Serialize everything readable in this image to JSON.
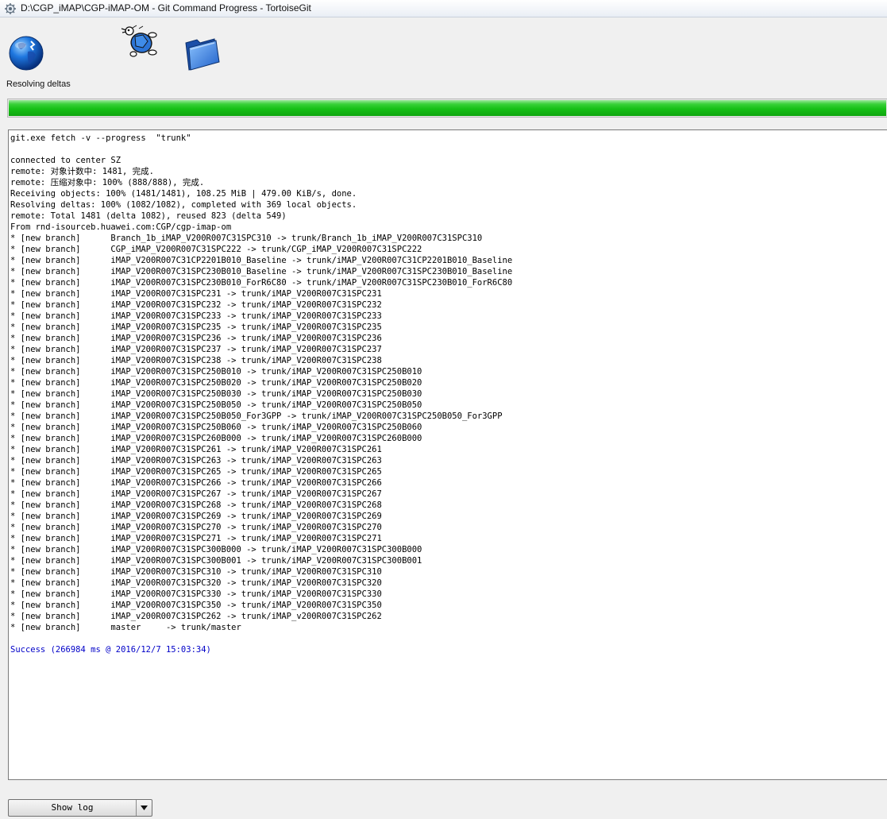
{
  "window": {
    "title": "D:\\CGP_iMAP\\CGP-iMAP-OM - Git Command Progress - TortoiseGit"
  },
  "status": {
    "text": "Resolving deltas",
    "progress_fraction": 1.0
  },
  "icons": {
    "app": "tortoisegit-icon",
    "remote": "globe-icon",
    "transfer": "turtle-icon",
    "local": "folder-icon"
  },
  "colors": {
    "progress": "#16c016",
    "success_text": "#0000c8"
  },
  "log": {
    "lines": [
      {
        "text": "git.exe fetch -v --progress  \"trunk\""
      },
      {
        "text": ""
      },
      {
        "text": "connected to center SZ"
      },
      {
        "text": "remote: 对象计数中: 1481, 完成."
      },
      {
        "text": "remote: 压缩对象中: 100% (888/888), 完成."
      },
      {
        "text": "Receiving objects: 100% (1481/1481), 108.25 MiB | 479.00 KiB/s, done."
      },
      {
        "text": "Resolving deltas: 100% (1082/1082), completed with 369 local objects."
      },
      {
        "text": "remote: Total 1481 (delta 1082), reused 823 (delta 549)"
      },
      {
        "text": "From rnd-isourceb.huawei.com:CGP/cgp-imap-om"
      },
      {
        "text": "* [new branch]      Branch_1b_iMAP_V200R007C31SPC310 -> trunk/Branch_1b_iMAP_V200R007C31SPC310"
      },
      {
        "text": "* [new branch]      CGP_iMAP_V200R007C31SPC222 -> trunk/CGP_iMAP_V200R007C31SPC222"
      },
      {
        "text": "* [new branch]      iMAP_V200R007C31CP2201B010_Baseline -> trunk/iMAP_V200R007C31CP2201B010_Baseline"
      },
      {
        "text": "* [new branch]      iMAP_V200R007C31SPC230B010_Baseline -> trunk/iMAP_V200R007C31SPC230B010_Baseline"
      },
      {
        "text": "* [new branch]      iMAP_V200R007C31SPC230B010_ForR6C80 -> trunk/iMAP_V200R007C31SPC230B010_ForR6C80"
      },
      {
        "text": "* [new branch]      iMAP_V200R007C31SPC231 -> trunk/iMAP_V200R007C31SPC231"
      },
      {
        "text": "* [new branch]      iMAP_V200R007C31SPC232 -> trunk/iMAP_V200R007C31SPC232"
      },
      {
        "text": "* [new branch]      iMAP_V200R007C31SPC233 -> trunk/iMAP_V200R007C31SPC233"
      },
      {
        "text": "* [new branch]      iMAP_V200R007C31SPC235 -> trunk/iMAP_V200R007C31SPC235"
      },
      {
        "text": "* [new branch]      iMAP_V200R007C31SPC236 -> trunk/iMAP_V200R007C31SPC236"
      },
      {
        "text": "* [new branch]      iMAP_V200R007C31SPC237 -> trunk/iMAP_V200R007C31SPC237"
      },
      {
        "text": "* [new branch]      iMAP_V200R007C31SPC238 -> trunk/iMAP_V200R007C31SPC238"
      },
      {
        "text": "* [new branch]      iMAP_V200R007C31SPC250B010 -> trunk/iMAP_V200R007C31SPC250B010"
      },
      {
        "text": "* [new branch]      iMAP_V200R007C31SPC250B020 -> trunk/iMAP_V200R007C31SPC250B020"
      },
      {
        "text": "* [new branch]      iMAP_V200R007C31SPC250B030 -> trunk/iMAP_V200R007C31SPC250B030"
      },
      {
        "text": "* [new branch]      iMAP_V200R007C31SPC250B050 -> trunk/iMAP_V200R007C31SPC250B050"
      },
      {
        "text": "* [new branch]      iMAP_V200R007C31SPC250B050_For3GPP -> trunk/iMAP_V200R007C31SPC250B050_For3GPP"
      },
      {
        "text": "* [new branch]      iMAP_V200R007C31SPC250B060 -> trunk/iMAP_V200R007C31SPC250B060"
      },
      {
        "text": "* [new branch]      iMAP_V200R007C31SPC260B000 -> trunk/iMAP_V200R007C31SPC260B000"
      },
      {
        "text": "* [new branch]      iMAP_V200R007C31SPC261 -> trunk/iMAP_V200R007C31SPC261"
      },
      {
        "text": "* [new branch]      iMAP_V200R007C31SPC263 -> trunk/iMAP_V200R007C31SPC263"
      },
      {
        "text": "* [new branch]      iMAP_V200R007C31SPC265 -> trunk/iMAP_V200R007C31SPC265"
      },
      {
        "text": "* [new branch]      iMAP_V200R007C31SPC266 -> trunk/iMAP_V200R007C31SPC266"
      },
      {
        "text": "* [new branch]      iMAP_V200R007C31SPC267 -> trunk/iMAP_V200R007C31SPC267"
      },
      {
        "text": "* [new branch]      iMAP_V200R007C31SPC268 -> trunk/iMAP_V200R007C31SPC268"
      },
      {
        "text": "* [new branch]      iMAP_V200R007C31SPC269 -> trunk/iMAP_V200R007C31SPC269"
      },
      {
        "text": "* [new branch]      iMAP_V200R007C31SPC270 -> trunk/iMAP_V200R007C31SPC270"
      },
      {
        "text": "* [new branch]      iMAP_V200R007C31SPC271 -> trunk/iMAP_V200R007C31SPC271"
      },
      {
        "text": "* [new branch]      iMAP_V200R007C31SPC300B000 -> trunk/iMAP_V200R007C31SPC300B000"
      },
      {
        "text": "* [new branch]      iMAP_V200R007C31SPC300B001 -> trunk/iMAP_V200R007C31SPC300B001"
      },
      {
        "text": "* [new branch]      iMAP_V200R007C31SPC310 -> trunk/iMAP_V200R007C31SPC310"
      },
      {
        "text": "* [new branch]      iMAP_V200R007C31SPC320 -> trunk/iMAP_V200R007C31SPC320"
      },
      {
        "text": "* [new branch]      iMAP_V200R007C31SPC330 -> trunk/iMAP_V200R007C31SPC330"
      },
      {
        "text": "* [new branch]      iMAP_V200R007C31SPC350 -> trunk/iMAP_V200R007C31SPC350"
      },
      {
        "text": "* [new branch]      iMAP_v200R007C31SPC262 -> trunk/iMAP_v200R007C31SPC262"
      },
      {
        "text": "* [new branch]      master     -> trunk/master"
      },
      {
        "text": ""
      },
      {
        "text": "Success (266984 ms @ 2016/12/7 15:03:34)",
        "kind": "success"
      }
    ]
  },
  "footer": {
    "show_log_label": "Show log"
  }
}
